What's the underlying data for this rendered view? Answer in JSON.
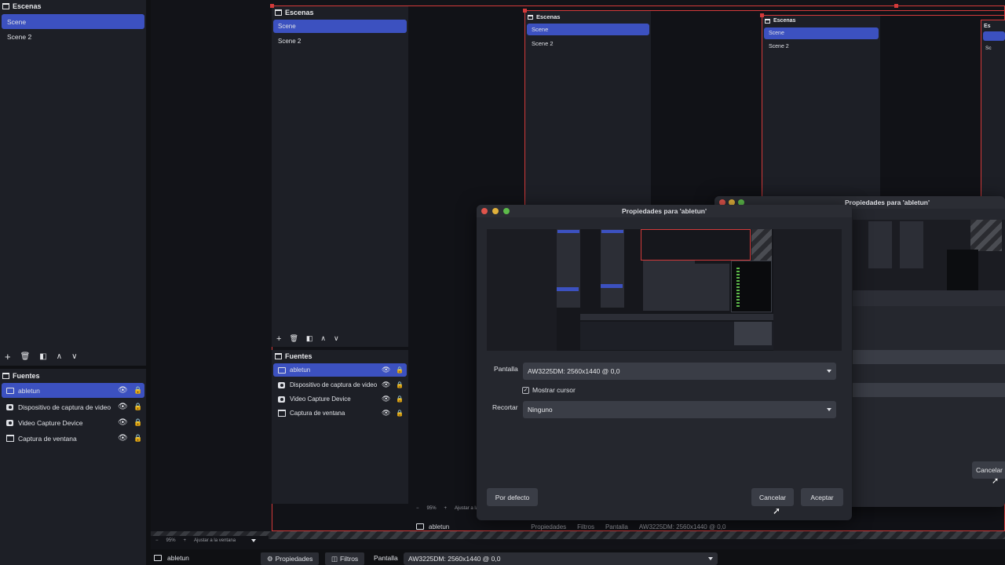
{
  "scenes": {
    "title": "Escenas",
    "items": [
      {
        "label": "Scene"
      },
      {
        "label": "Scene 2"
      }
    ]
  },
  "sources": {
    "title": "Fuentes",
    "items": [
      {
        "label": "abletun",
        "icon": "display-icon"
      },
      {
        "label": "Dispositivo de captura de video",
        "icon": "camera-icon"
      },
      {
        "label": "Video Capture Device",
        "icon": "camera-icon"
      },
      {
        "label": "Captura de ventana",
        "icon": "window-icon"
      }
    ]
  },
  "toolbar": {
    "add": "+",
    "remove": "🗑",
    "filter": "◧",
    "up": "∧",
    "down": "∨"
  },
  "nested": {
    "scenes_title": "Escenas",
    "sources_title": "Fuentes",
    "scene1": "Scene",
    "scene2": "Scene 2",
    "zoom": "95%",
    "fit_label": "Ajustar a la ventana",
    "status_source": "abletun",
    "status_props": "Propiedades",
    "status_filters": "Filtros",
    "status_screen": "Pantalla",
    "status_screen_value": "AW3225DM: 2560x1440 @ 0,0"
  },
  "bottom_bar": {
    "zoom": "95%",
    "fit_label": "Ajustar a la ventana",
    "source": "abletun",
    "properties": "Propiedades",
    "filters": "Filtros",
    "screen_label": "Pantalla",
    "screen_value": "AW3225DM: 2560x1440 @ 0,0"
  },
  "dialog": {
    "title": "Propiedades para 'abletun'",
    "screen_label": "Pantalla",
    "screen_value": "AW3225DM: 2560x1440 @ 0,0",
    "cursor_label": "Mostrar cursor",
    "cursor_checked": true,
    "crop_label": "Recortar",
    "crop_value": "Ninguno",
    "defaults": "Por defecto",
    "cancel": "Cancelar",
    "accept": "Aceptar"
  },
  "bg_dialog": {
    "title": "Propiedades para 'abletun'",
    "cancel": "Cancelar"
  },
  "colors": {
    "accent": "#3c51c0",
    "outline": "#d33a3a",
    "panel": "#1d1f26"
  }
}
